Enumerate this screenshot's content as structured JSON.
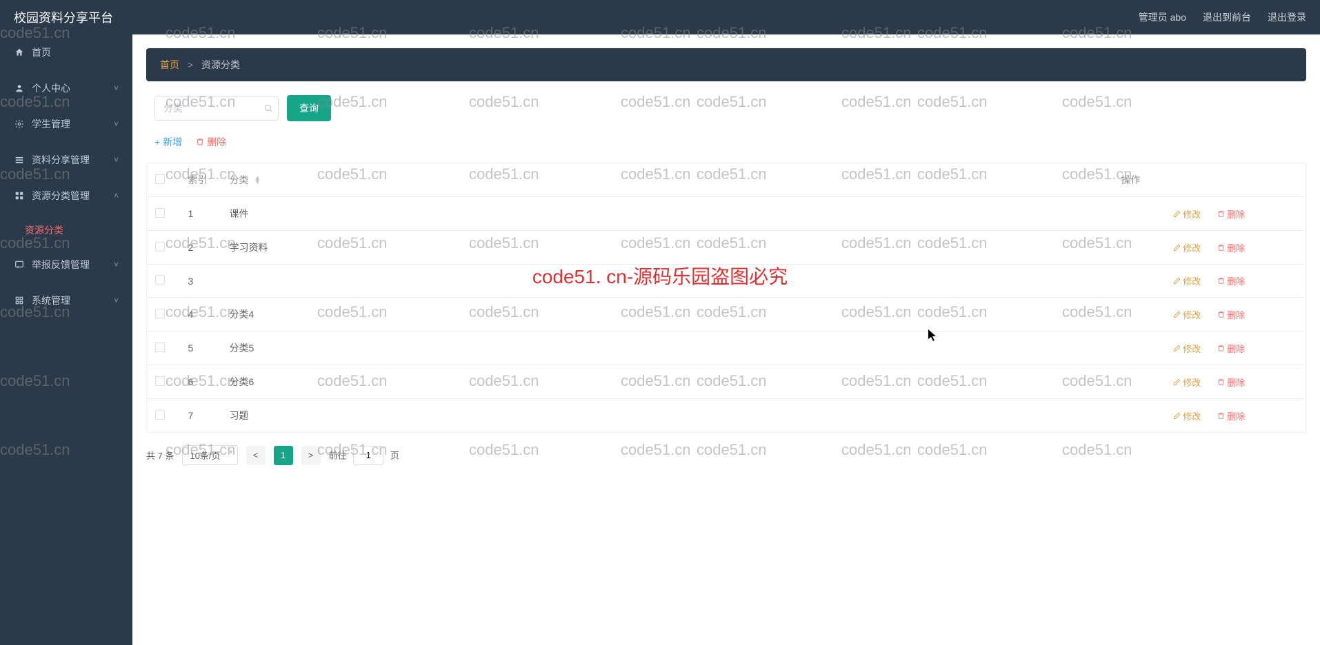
{
  "header": {
    "title": "校园资料分享平台",
    "admin_label": "管理员 abo",
    "exit_front_label": "退出到前台",
    "logout_label": "退出登录"
  },
  "sidebar": {
    "items": [
      {
        "icon": "home",
        "label": "首页",
        "type": "link"
      },
      {
        "icon": "user",
        "label": "个人中心",
        "type": "submenu",
        "expanded": false
      },
      {
        "icon": "gear",
        "label": "学生管理",
        "type": "submenu",
        "expanded": false
      },
      {
        "icon": "share",
        "label": "资料分享管理",
        "type": "submenu",
        "expanded": false
      },
      {
        "icon": "category",
        "label": "资源分类管理",
        "type": "submenu",
        "expanded": true,
        "children": [
          {
            "label": "资源分类",
            "active": true
          }
        ]
      },
      {
        "icon": "feedback",
        "label": "举报反馈管理",
        "type": "submenu",
        "expanded": false
      },
      {
        "icon": "system",
        "label": "系统管理",
        "type": "submenu",
        "expanded": false
      }
    ]
  },
  "breadcrumb": {
    "home": "首页",
    "current": "资源分类"
  },
  "search": {
    "placeholder": "分类",
    "button_label": "查询"
  },
  "actions": {
    "add_label": "新增",
    "delete_label": "删除"
  },
  "table": {
    "headers": {
      "index": "索引",
      "category": "分类",
      "action": "操作"
    },
    "row_actions": {
      "edit": "修改",
      "delete": "删除"
    },
    "rows": [
      {
        "index": "1",
        "category": "课件"
      },
      {
        "index": "2",
        "category": "学习资料"
      },
      {
        "index": "3",
        "category": ""
      },
      {
        "index": "4",
        "category": "分类4"
      },
      {
        "index": "5",
        "category": "分类5"
      },
      {
        "index": "6",
        "category": "分类6"
      },
      {
        "index": "7",
        "category": "习题"
      }
    ]
  },
  "pagination": {
    "total_label": "共 7 条",
    "per_page": "10条/页",
    "current_page": "1",
    "jump_prefix": "前往",
    "jump_suffix": "页",
    "jump_value": "1"
  },
  "watermark": {
    "small": "code51.cn",
    "center": "code51. cn-源码乐园盗图必究"
  }
}
